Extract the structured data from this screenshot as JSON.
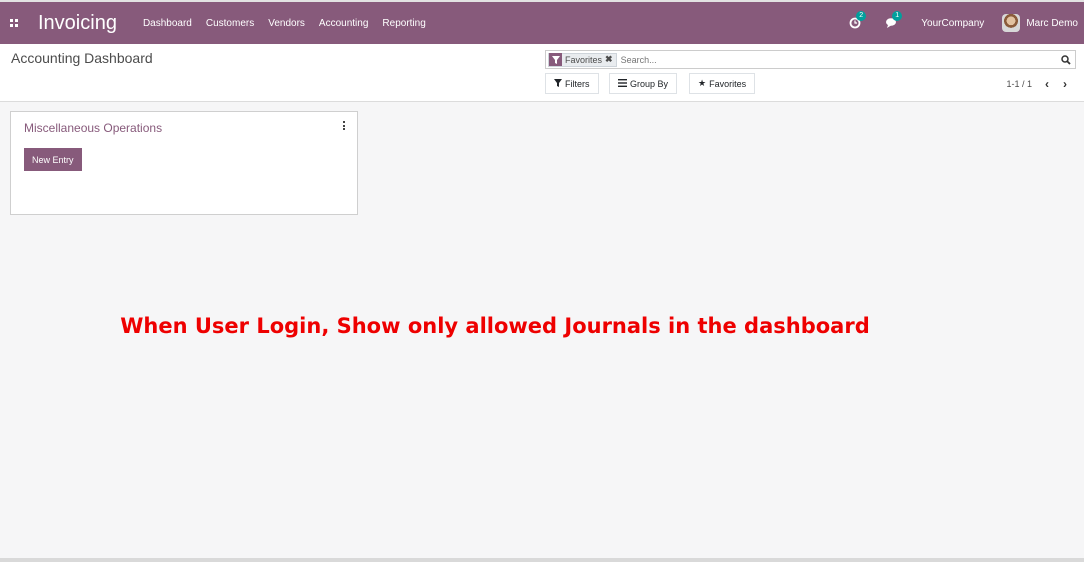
{
  "navbar": {
    "app_title": "Invoicing",
    "menu": [
      "Dashboard",
      "Customers",
      "Vendors",
      "Accounting",
      "Reporting"
    ],
    "activity_count": "2",
    "messages_count": "1",
    "company": "YourCompany",
    "user_name": "Marc Demo",
    "brand_color": "#875a7b"
  },
  "control_panel": {
    "page_title": "Accounting Dashboard",
    "search": {
      "facet_label": "Favorites",
      "placeholder": "Search..."
    },
    "buttons": {
      "filters": "Filters",
      "group_by": "Group By",
      "favorites": "Favorites"
    },
    "pager": "1-1 / 1"
  },
  "journal_card": {
    "title": "Miscellaneous Operations",
    "action_button": "New Entry"
  },
  "annotation": {
    "text": "When User Login, Show only allowed Journals in the dashboard",
    "color": "#ee0000"
  }
}
